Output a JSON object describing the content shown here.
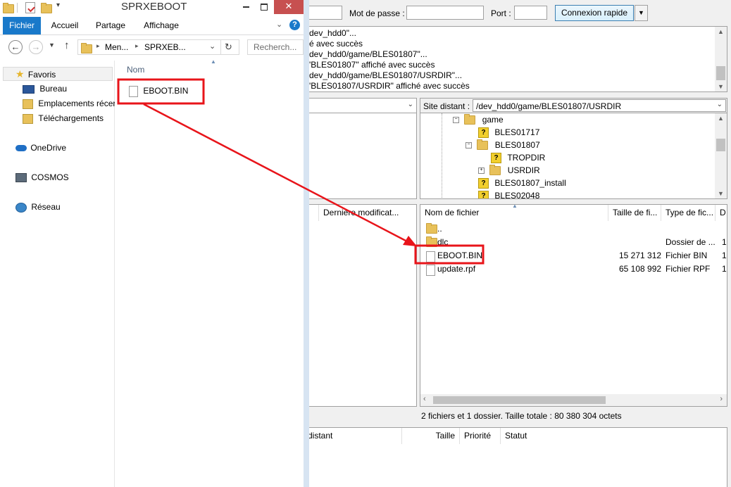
{
  "filezilla": {
    "quickconnect": {
      "password_label": "Mot de passe :",
      "port_label": "Port :",
      "connect_button": "Connexion rapide",
      "dropdown_arrow": "▼"
    },
    "log_lines": [
      "dev_hdd0\"...",
      "é avec succès",
      "dev_hdd0/game/BLES01807\"...",
      "'BLES01807\" affiché avec succès",
      "dev_hdd0/game/BLES01807/USRDIR\"...",
      "'BLES01807/USRDIR\" affiché avec succès"
    ],
    "remote_site_label": "Site distant :",
    "remote_site_path": "/dev_hdd0/game/BLES01807/USRDIR",
    "remote_tree": [
      {
        "label": "game",
        "icon": "folder",
        "expander": "−"
      },
      {
        "label": "BLES01717",
        "icon": "question"
      },
      {
        "label": "BLES01807",
        "icon": "folder",
        "expander": "−"
      },
      {
        "label": "TROPDIR",
        "icon": "question"
      },
      {
        "label": "USRDIR",
        "icon": "folder",
        "expander": "+"
      },
      {
        "label": "BLES01807_install",
        "icon": "question"
      },
      {
        "label": "BLES02048",
        "icon": "question"
      }
    ],
    "local_columns": {
      "last_modified": "Dernière modificat..."
    },
    "remote_columns": {
      "filename": "Nom de fichier",
      "size": "Taille de fi...",
      "type": "Type de fic...",
      "extra": "D"
    },
    "remote_files": [
      {
        "name": "..",
        "size": "",
        "type": "",
        "extra": "",
        "icon": "folder"
      },
      {
        "name": "dlc",
        "size": "",
        "type": "Dossier de ...",
        "extra": "1(",
        "icon": "folder"
      },
      {
        "name": "EBOOT.BIN",
        "size": "15 271 312",
        "type": "Fichier BIN",
        "extra": "1",
        "icon": "file"
      },
      {
        "name": "update.rpf",
        "size": "65 108 992",
        "type": "Fichier RPF",
        "extra": "1",
        "icon": "file"
      }
    ],
    "remote_status": "2 fichiers et 1 dossier. Taille totale : 80 380 304 octets",
    "queue_columns": {
      "remote": "distant",
      "size": "Taille",
      "priority": "Priorité",
      "status": "Statut"
    }
  },
  "explorer": {
    "title": "SPRXEBOOT",
    "ribbon_tabs": {
      "file": "Fichier",
      "home": "Accueil",
      "share": "Partage",
      "view": "Affichage"
    },
    "breadcrumb": {
      "part1": "Men...",
      "part2": "SPRXEB..."
    },
    "search_placeholder": "Recherch...",
    "nav": {
      "favorites": "Favoris",
      "desktop": "Bureau",
      "recent": "Emplacements récer",
      "downloads": "Téléchargements",
      "onedrive": "OneDrive",
      "computer": "COSMOS",
      "network": "Réseau"
    },
    "column_name": "Nom",
    "files": [
      {
        "name": "EBOOT.BIN"
      }
    ]
  },
  "colors": {
    "highlight_red": "#e8141a",
    "ribbon_blue": "#1979ca",
    "close_red": "#c75050"
  }
}
